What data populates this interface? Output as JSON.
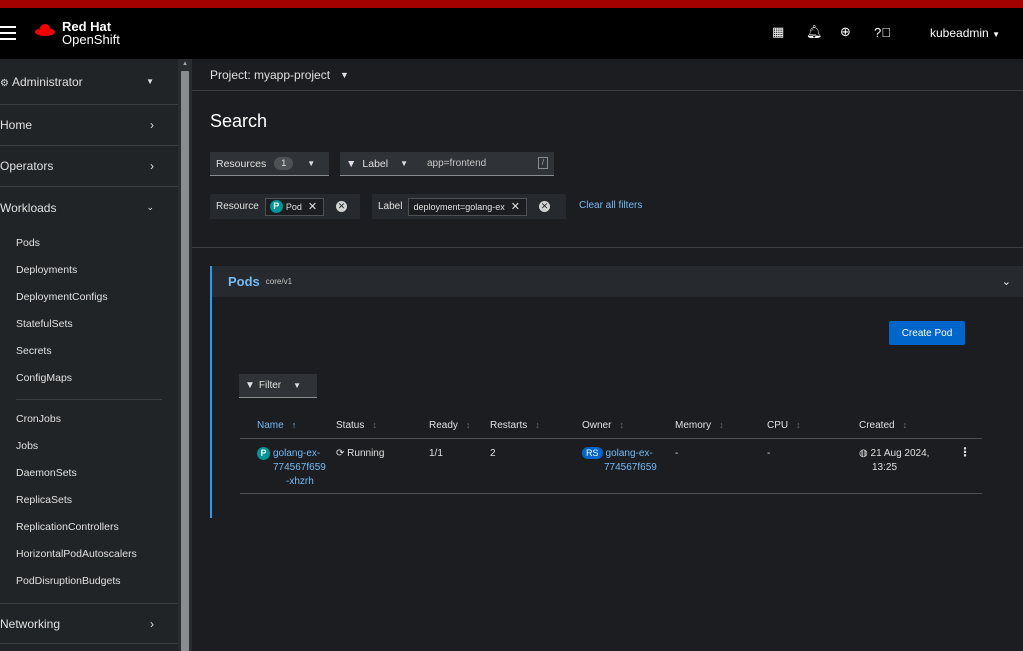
{
  "masthead": {
    "brand_line1": "Red Hat",
    "brand_line2": "OpenShift",
    "user": "kubeadmin",
    "icons": [
      "grid-icon",
      "bell-icon",
      "plus-circle-icon",
      "help-icon"
    ]
  },
  "sidebar": {
    "perspective": "Administrator",
    "sections": {
      "home": "Home",
      "operators": "Operators",
      "workloads": "Workloads",
      "networking": "Networking"
    },
    "workload_items": [
      "Pods",
      "Deployments",
      "DeploymentConfigs",
      "StatefulSets",
      "Secrets",
      "ConfigMaps"
    ],
    "workload_items_2": [
      "CronJobs",
      "Jobs",
      "DaemonSets",
      "ReplicaSets",
      "ReplicationControllers",
      "HorizontalPodAutoscalers",
      "PodDisruptionBudgets"
    ]
  },
  "project": {
    "label": "Project: myapp-project"
  },
  "page": {
    "title": "Search"
  },
  "toolbar": {
    "resources_label": "Resources",
    "resources_count": "1",
    "label_dropdown": "Label",
    "label_input_value": "app=frontend",
    "shortcut_key": "/"
  },
  "filters": {
    "resource_group_label": "Resource",
    "resource_chip": "Pod",
    "resource_chip_badge": "P",
    "label_group_label": "Label",
    "label_chip": "deployment=golang-ex",
    "clear_all": "Clear all filters"
  },
  "card": {
    "title": "Pods",
    "version": "core/v1",
    "create_button": "Create Pod",
    "filter_button": "Filter"
  },
  "table": {
    "columns": [
      "Name",
      "Status",
      "Ready",
      "Restarts",
      "Owner",
      "Memory",
      "CPU",
      "Created"
    ],
    "rows": [
      {
        "badge": "P",
        "name_l1": "golang-ex-",
        "name_l2": "774567f659",
        "name_l3": "-xhzrh",
        "status": "Running",
        "ready": "1/1",
        "restarts": "2",
        "owner_badge": "RS",
        "owner_l1": "golang-ex-",
        "owner_l2": "774567f659",
        "memory": "-",
        "cpu": "-",
        "created_l1": "21 Aug 2024,",
        "created_l2": "13:25"
      }
    ]
  }
}
